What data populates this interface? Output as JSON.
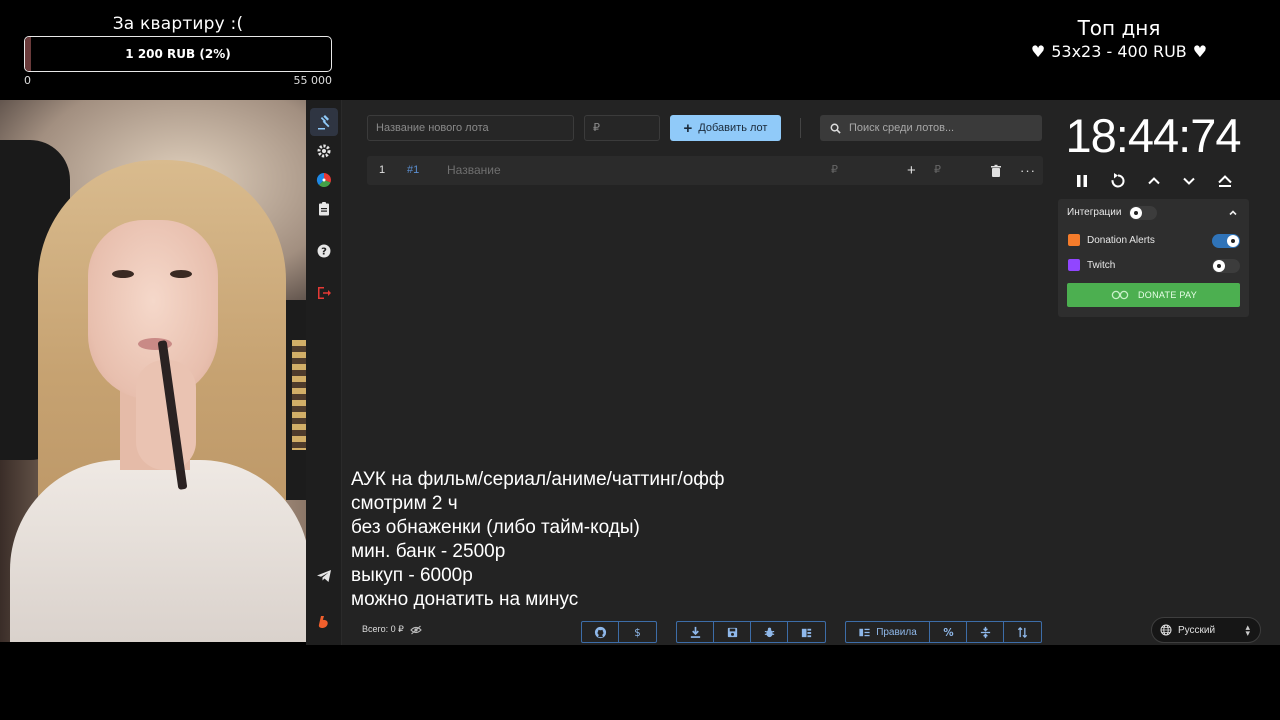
{
  "goal": {
    "title": "За квартиру :(",
    "progress_text": "1 200 RUB (2%)",
    "progress_fraction": 0.02,
    "min": "0",
    "max": "55 000",
    "fill_color": "#6a3b3b"
  },
  "top_day": {
    "title": "Топ дня",
    "entry": "53x23 - 400 RUB",
    "heart_icon": "heart-icon"
  },
  "sidebar": {
    "items": [
      {
        "name": "auction-icon",
        "active": true
      },
      {
        "name": "settings-icon"
      },
      {
        "name": "wheel-icon"
      },
      {
        "name": "history-icon"
      },
      {
        "name": "help-icon"
      },
      {
        "name": "logout-icon"
      },
      {
        "name": "telegram-icon"
      },
      {
        "name": "boosty-icon"
      }
    ]
  },
  "toolbar": {
    "new_lot_placeholder": "Название нового лота",
    "amount_placeholder": "₽",
    "add_button": "Добавить лот",
    "search_placeholder": "Поиск среди лотов..."
  },
  "lots": [
    {
      "index": "1",
      "id": "#1",
      "name_placeholder": "Название",
      "amount_placeholder": "₽",
      "add_placeholder": "₽"
    }
  ],
  "timer": {
    "display": "18:44:74",
    "controls": [
      "pause-icon",
      "reset-icon",
      "chevron-up-icon",
      "chevron-down-icon",
      "eject-icon"
    ]
  },
  "integrations": {
    "title": "Интеграции",
    "enabled": false,
    "services": [
      {
        "label": "Donation Alerts",
        "enabled": true,
        "color": "#f57c2b"
      },
      {
        "label": "Twitch",
        "enabled": false,
        "color": "#9146ff"
      }
    ],
    "donatepay_label": "DONATE PAY"
  },
  "rules": {
    "lines": [
      "АУК на фильм/сериал/аниме/чаттинг/офф",
      "смотрим 2 ч",
      "без обнаженки (либо тайм-коды)",
      "мин. банк - 2500р",
      "выкуп - 6000р",
      "можно донатить на минус"
    ]
  },
  "footer": {
    "total": "Всего: 0 ₽",
    "rules_button": "Правила",
    "language": "Русский"
  },
  "colors": {
    "accent": "#90caf9",
    "app_bg": "#232323",
    "donatepay": "#4caf50"
  }
}
